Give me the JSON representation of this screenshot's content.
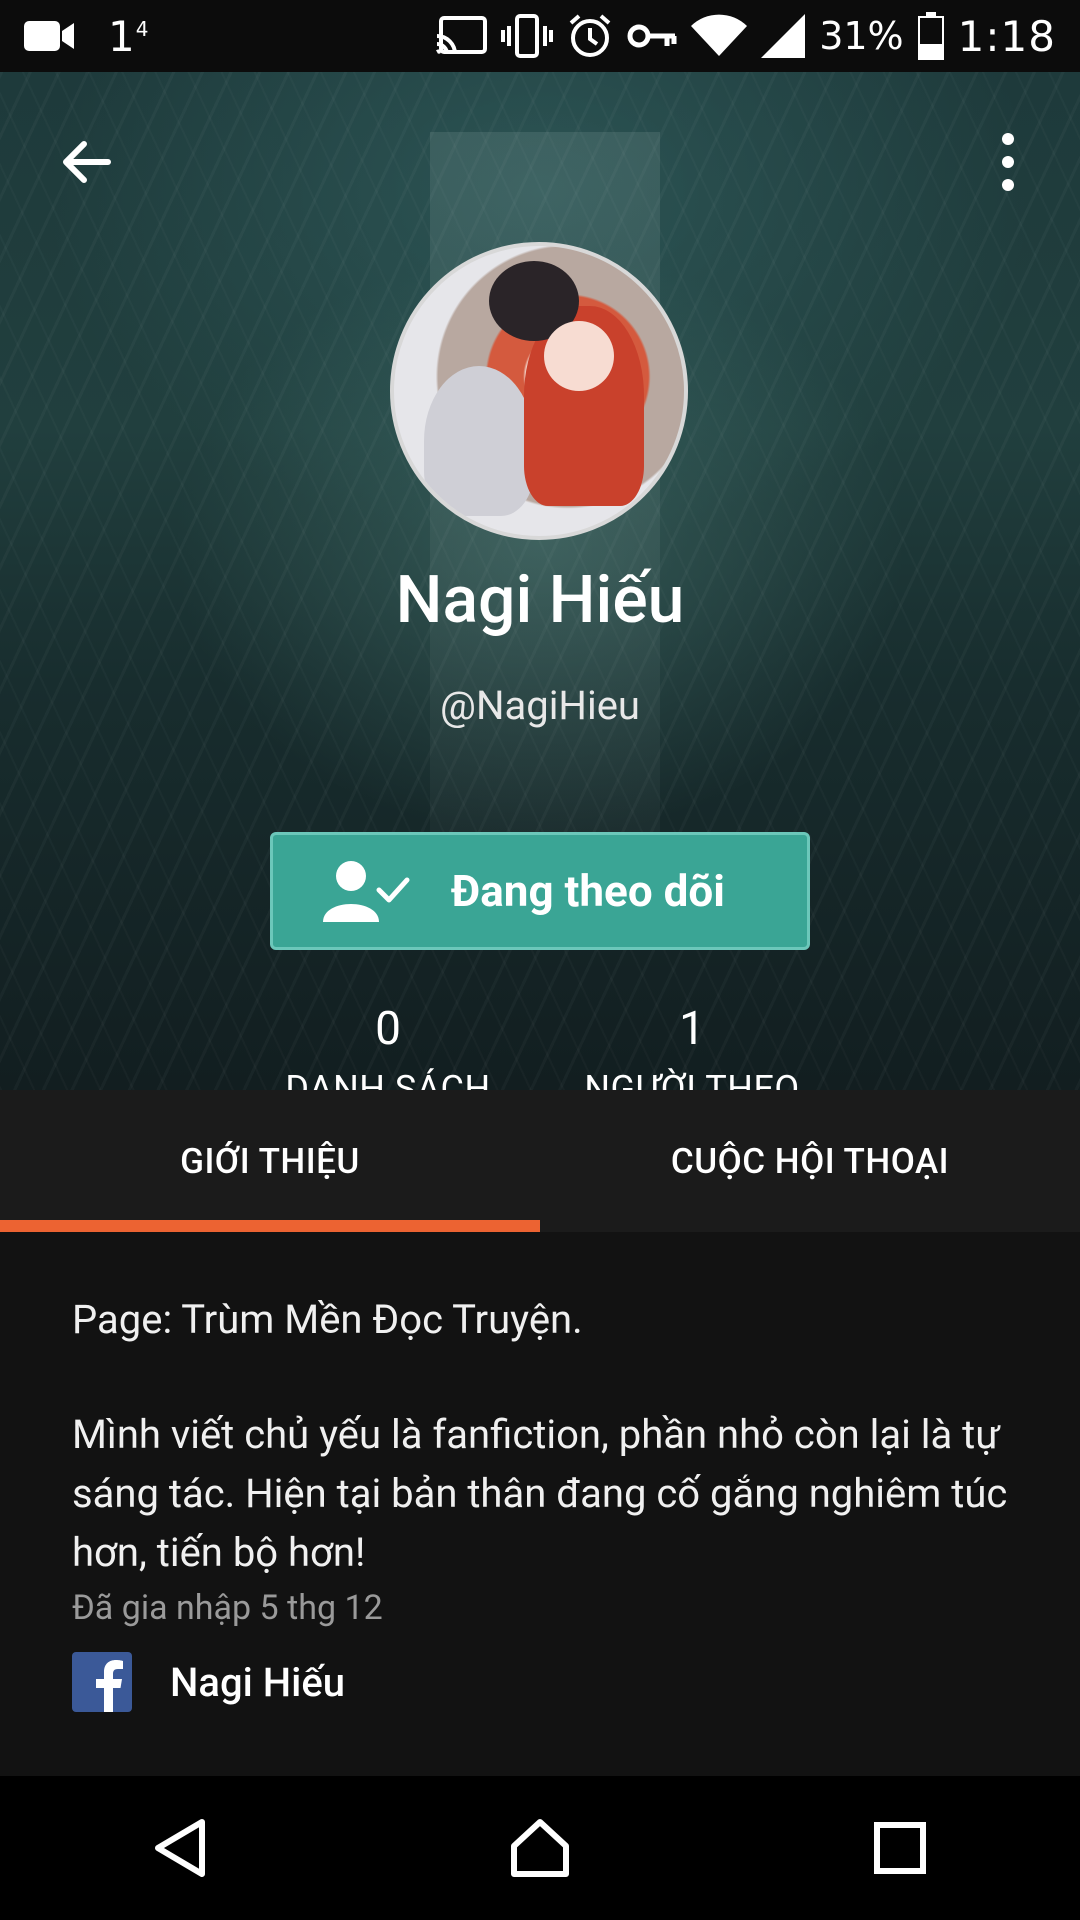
{
  "status_bar": {
    "notification_count": "1",
    "notification_sup": "4",
    "battery_percent": "31%",
    "time": "1:18"
  },
  "profile": {
    "display_name": "Nagi Hiếu",
    "username": "@NagiHieu",
    "follow_button_label": "Đang theo dõi",
    "reading_list_count": "0",
    "reading_list_label": "DANH SÁCH ĐỌC",
    "followers_count": "1",
    "followers_label": "NGƯỜI THEO DÕI"
  },
  "tabs": [
    {
      "label": "GIỚI THIỆU",
      "active": true
    },
    {
      "label": "CUỘC HỘI THOẠI",
      "active": false
    }
  ],
  "about": {
    "page_line": "Page: Trùm Mền Đọc Truyện.",
    "bio": "Mình viết chủ yếu là fanfiction, phần nhỏ còn lại là tự sáng tác. Hiện tại bản thân đang cố gắng nghiêm túc hơn, tiến bộ hơn!",
    "joined": "Đã gia nhập 5 thg 12",
    "facebook_name": "Nagi Hiếu"
  },
  "colors": {
    "accent_tab": "#ec6332",
    "follow_button": "#3aa595",
    "facebook": "#3b5998"
  },
  "icons": {
    "back": "arrow-left-icon",
    "more": "more-vertical-icon",
    "follow": "user-check-icon",
    "facebook": "facebook-icon",
    "nav_back": "triangle-back-icon",
    "nav_home": "home-icon",
    "nav_recents": "square-recents-icon"
  }
}
